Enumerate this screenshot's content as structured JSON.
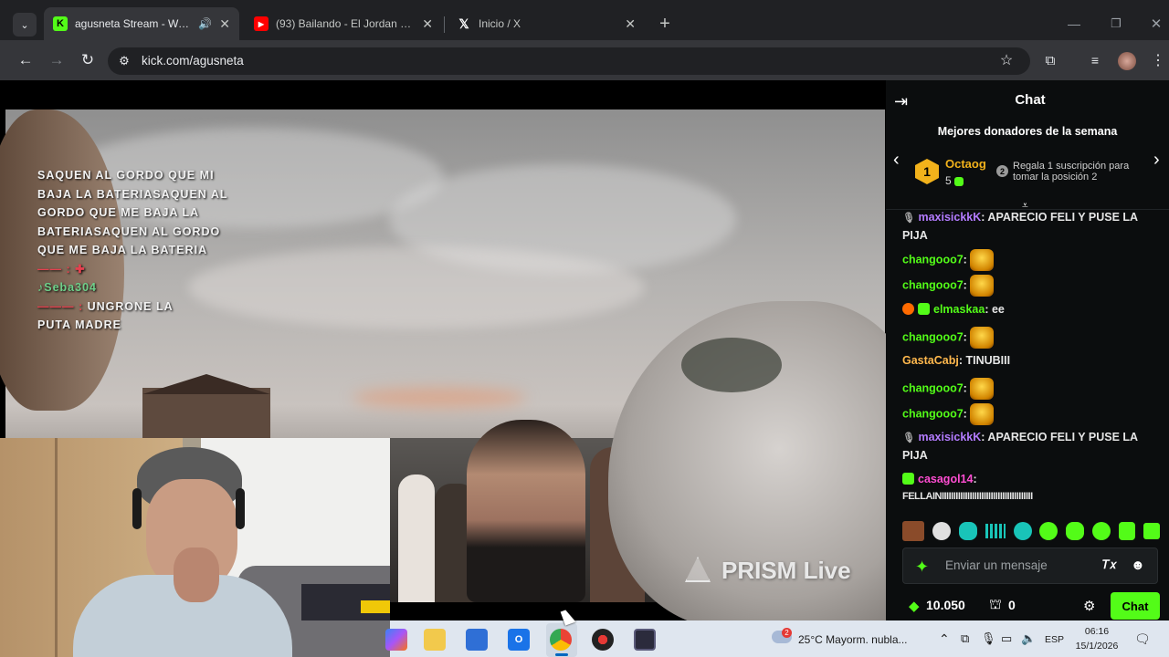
{
  "browser": {
    "tabs": [
      {
        "title": "agusneta Stream - Watch Live on Kick",
        "favicon": "K",
        "active": true
      },
      {
        "title": "(93) Bailando - El Jordan 23 / Stream",
        "favicon": "yt"
      },
      {
        "title": "Inicio / X",
        "favicon": "X"
      }
    ],
    "url": "kick.com/agusneta"
  },
  "video": {
    "overlay_lines": [
      "SAQUEN AL GORDO QUE MI",
      "BAJA LA BATERIASAQUEN AL",
      "GORDO QUE ME BAJA LA",
      "BATERIASAQUEN AL GORDO",
      "QUE ME BAJA LA BATERIA"
    ],
    "overlay_user1": "Seba304",
    "overlay_tail": "UNGRONE LA",
    "overlay_last": "PUTA MADRE",
    "watermark": "PRISM Live"
  },
  "chat": {
    "title": "Chat",
    "donors_title": "Mejores donadores de la semana",
    "top_donor": {
      "rank": "1",
      "name": "Octaog",
      "count": "5"
    },
    "next_rank": "2",
    "next_text": "Regala 1 suscripción para tomar la posición 2",
    "messages": [
      {
        "user": "maxisickkK",
        "text": ": APARECIO FELI Y PUSE LA PIJA",
        "color": "#b47cff"
      },
      {
        "user": "changooo7",
        "text": ":",
        "color": "#53fc18",
        "emote": true
      },
      {
        "user": "changooo7",
        "text": ":",
        "color": "#53fc18",
        "emote": true
      },
      {
        "user": "elmaskaa",
        "text": ": ee",
        "color": "#53fc18"
      },
      {
        "user": "changooo7",
        "text": ":",
        "color": "#53fc18",
        "emote": true
      },
      {
        "user": "GastaCabj",
        "text": ": TINUBIII",
        "color": "#ffb84d"
      },
      {
        "user": "changooo7",
        "text": ":",
        "color": "#53fc18",
        "emote": true
      },
      {
        "user": "changooo7",
        "text": ":",
        "color": "#53fc18",
        "emote": true
      },
      {
        "user": "maxisickkK",
        "text": ": APARECIO FELI Y PUSE LA PIJA",
        "color": "#b47cff"
      },
      {
        "user": "casagol14",
        "text": ":",
        "color": "#ff4dd2"
      },
      {
        "user": "",
        "text": "FELLAINIIIIIIIIIIIIIIIIIIIIIIIIIIIIIIIIIIIIIII",
        "color": "#e6e6e6"
      }
    ],
    "input_placeholder": "Enviar un mensaje",
    "kicks": "10.050",
    "gifts": "0",
    "send_label": "Chat"
  },
  "taskbar": {
    "notification_count": "2",
    "weather": "25°C  Mayorm. nubla...",
    "lang": "ESP",
    "time": "06:16",
    "date": "15/1/2026"
  },
  "colors": {
    "kick_green": "#53fc18",
    "chrome_dark": "#202124",
    "chat_bg": "#0b0d0e"
  }
}
